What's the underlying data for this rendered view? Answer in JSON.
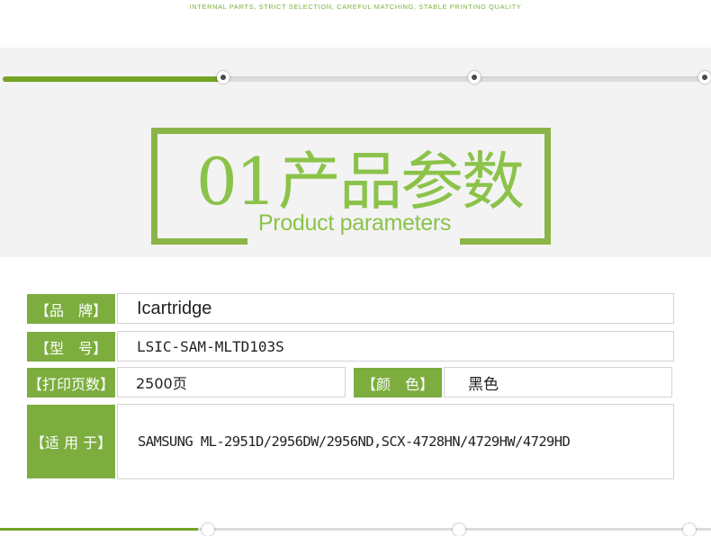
{
  "tagline": "INTERNAL PARTS, STRICT SELECTION, CAREFUL MATCHING, STABLE PRINTING QUALITY",
  "progress": {
    "filled_fraction": 0.31,
    "steps": 3,
    "active_step": 1
  },
  "section": {
    "number": "01",
    "title_cn": "产品参数",
    "title_en": "Product parameters"
  },
  "params": {
    "brand_label": "【品　牌】",
    "brand_value": "Icartridge",
    "model_label": "【型　号】",
    "model_value": "LSIC-SAM-MLTD103S",
    "pages_label": "【打印页数】",
    "pages_value": "2500页",
    "color_label": "【颜　色】",
    "color_value": "黑色",
    "compat_label": "【适 用 于】",
    "compat_value": "SAMSUNG ML-2951D/2956DW/2956ND,SCX-4728HN/4729HW/4729HD"
  },
  "colors": {
    "accent": "#7cad3e",
    "title_green": "#8bc34a",
    "band": "#f3f3f3"
  }
}
